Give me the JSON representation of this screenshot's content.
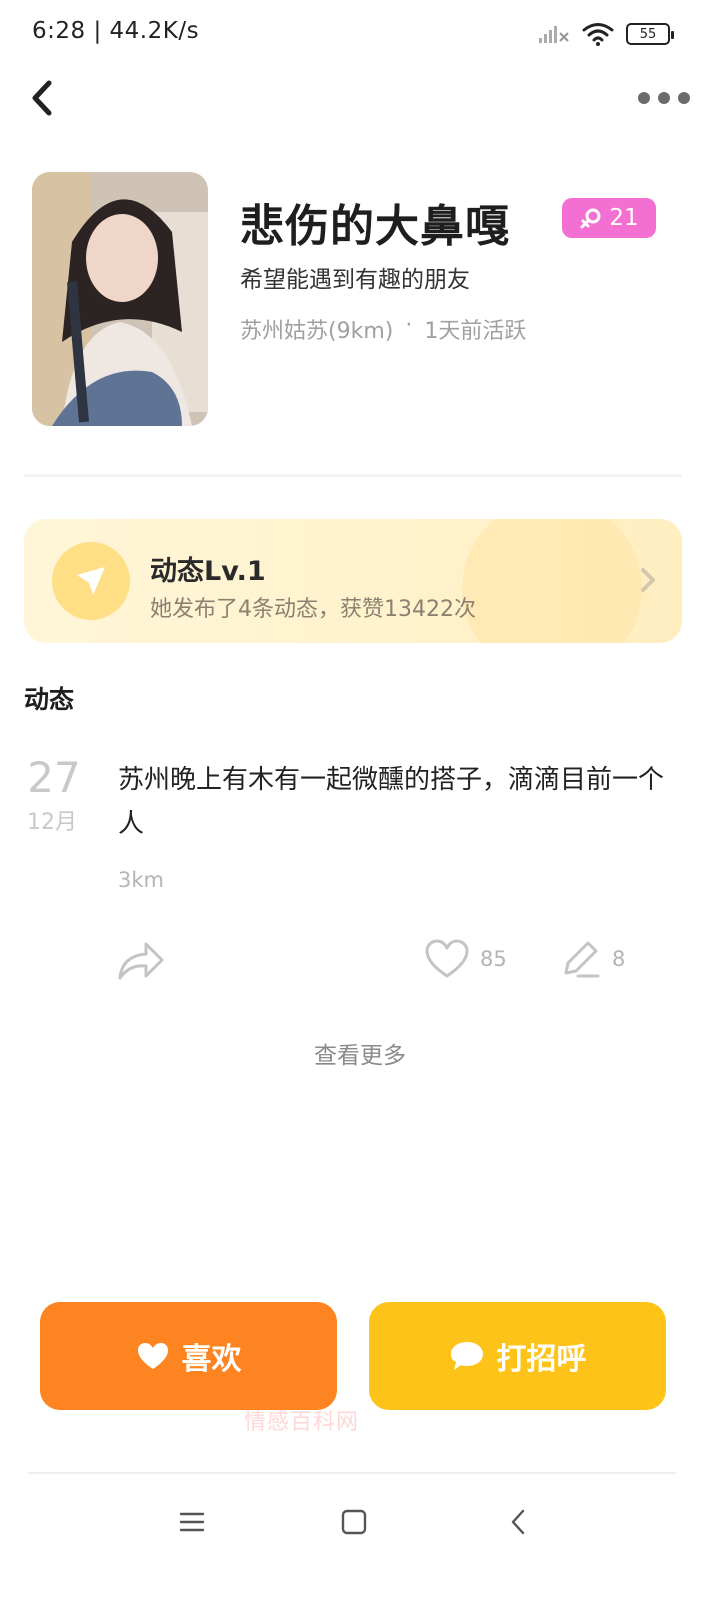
{
  "status_bar": {
    "time_speed": "6:28 | 44.2K/s",
    "battery": "55",
    "icons": [
      "signal-off-icon",
      "wifi-icon",
      "battery-icon"
    ]
  },
  "nav": {
    "icons": [
      "back-arrow-icon",
      "more-dots-icon"
    ]
  },
  "profile": {
    "name": "悲伤的大鼻嘎",
    "badge_age": "21",
    "badge_icon": "female-icon",
    "badge_color": "#f36fd2",
    "bio": "希望能遇到有趣的朋友",
    "location": "苏州姑苏(9km)",
    "separator": "·",
    "active": "1天前活跃"
  },
  "level_card": {
    "title": "动态Lv.1",
    "subtitle": "她发布了4条动态，获赞13422次",
    "icon": "paper-plane-icon"
  },
  "section": {
    "title": "动态"
  },
  "post": {
    "day": "27",
    "month": "12月",
    "text": "苏州晚上有木有一起微醺的搭子，滴滴目前一个人",
    "distance": "3km",
    "likes": "85",
    "comments": "8",
    "icons": [
      "share-icon",
      "heart-outline-icon",
      "pen-icon"
    ]
  },
  "see_more": "查看更多",
  "actions": {
    "like_label": "喜欢",
    "greet_label": "打招呼",
    "like_color": "#fd8420",
    "greet_color": "#fdc318"
  },
  "watermark": "情感百科网",
  "system_nav": {
    "icons": [
      "menu-icon",
      "home-square-icon",
      "back-chevron-icon"
    ]
  }
}
